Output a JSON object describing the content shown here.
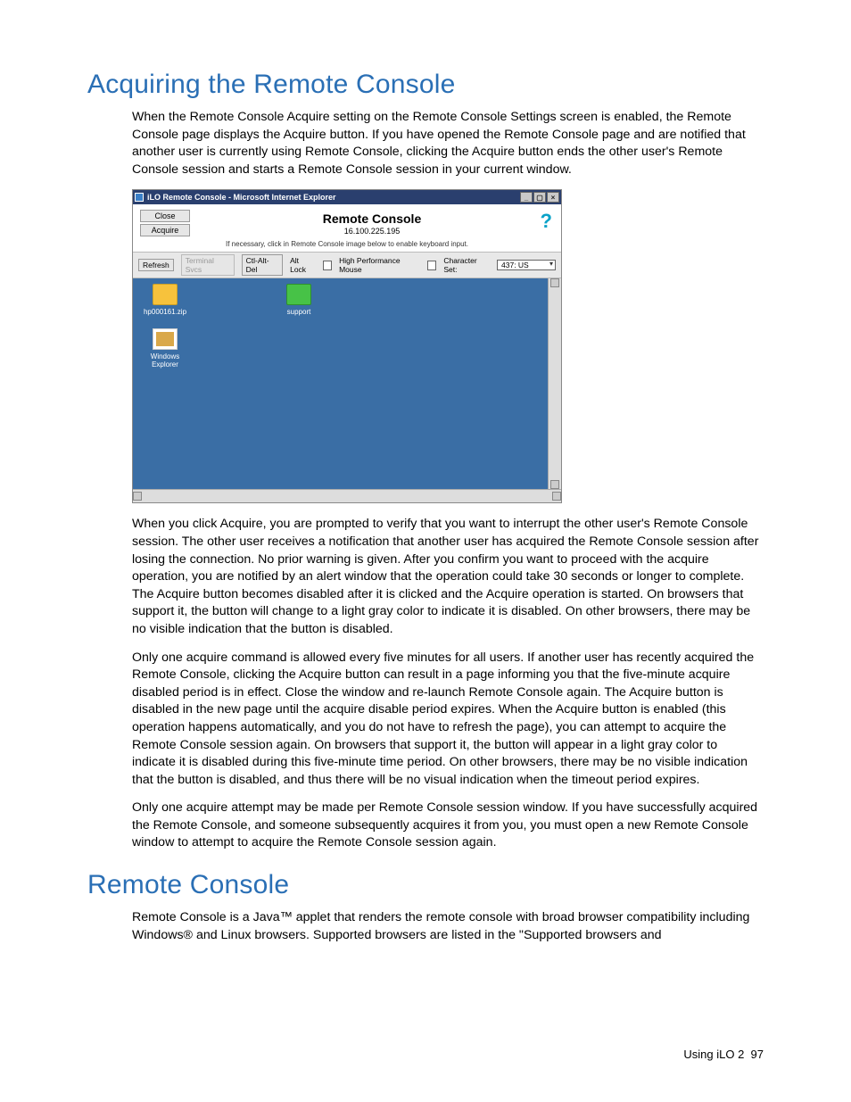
{
  "headings": {
    "h1": "Acquiring the Remote Console",
    "h2": "Remote Console"
  },
  "paragraphs": {
    "p1": "When the Remote Console Acquire setting on the Remote Console Settings screen is enabled, the Remote Console page displays the Acquire button. If you have opened the Remote Console page and are notified that another user is currently using Remote Console, clicking the Acquire button ends the other user's Remote Console session and starts a Remote Console session in your current window.",
    "p2": "When you click Acquire, you are prompted to verify that you want to interrupt the other user's Remote Console session. The other user receives a notification that another user has acquired the Remote Console session after losing the connection. No prior warning is given. After you confirm you want to proceed with the acquire operation, you are notified by an alert window that the operation could take 30 seconds or longer to complete. The Acquire button becomes disabled after it is clicked and the Acquire operation is started. On browsers that support it, the button will change to a light gray color to indicate it is disabled. On other browsers, there may be no visible indication that the button is disabled.",
    "p3": "Only one acquire command is allowed every five minutes for all users. If another user has recently acquired the Remote Console, clicking the Acquire button can result in a page informing you that the five-minute acquire disabled period is in effect. Close the window and re-launch Remote Console again. The Acquire button is disabled in the new page until the acquire disable period expires. When the Acquire button is enabled (this operation happens automatically, and you do not have to refresh the page), you can attempt to acquire the Remote Console session again. On browsers that support it, the button will appear in a light gray color to indicate it is disabled during this five-minute time period. On other browsers, there may be no visible indication that the button is disabled, and thus there will be no visual indication when the timeout period expires.",
    "p4": "Only one acquire attempt may be made per Remote Console session window. If you have successfully acquired the Remote Console, and someone subsequently acquires it from you, you must open a new Remote Console window to attempt to acquire the Remote Console session again.",
    "p5": "Remote Console is a Java™ applet that renders the remote console with broad browser compatibility including Windows® and Linux browsers. Supported browsers are listed in the \"Supported browsers and"
  },
  "screenshot": {
    "window_title": "iLO Remote Console - Microsoft Internet Explorer",
    "buttons": {
      "close": "Close",
      "acquire": "Acquire"
    },
    "title": "Remote Console",
    "ip": "16.100.225.195",
    "hint": "If necessary, click in Remote Console image below to enable keyboard input.",
    "toolbar": {
      "refresh": "Refresh",
      "terminal": "Terminal Svcs",
      "ctrlaltdel": "Ctl-Alt-Del",
      "altlock": "Alt Lock",
      "hpm": "High Performance Mouse",
      "charset_label": "Character Set:",
      "charset_value": "437: US"
    },
    "desktop_icons": {
      "i1": "hp000161.zip",
      "i2": "support",
      "i3": "Windows Explorer"
    },
    "help": "?"
  },
  "footer": {
    "label": "Using iLO 2",
    "page": "97"
  }
}
